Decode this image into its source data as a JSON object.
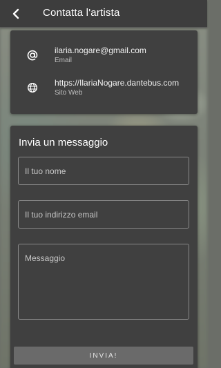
{
  "header": {
    "title": "Contatta l'artista",
    "back_icon": "chevron-left-icon"
  },
  "contact_info": [
    {
      "icon": "at-sign-icon",
      "value": "ilaria.nogare@gmail.com",
      "label": "Email"
    },
    {
      "icon": "globe-icon",
      "value": "https://IlariaNogare.dantebus.com",
      "label": "Sito Web"
    }
  ],
  "message_form": {
    "title": "Invia un messaggio",
    "name_placeholder": "Il tuo nome",
    "name_value": "",
    "email_placeholder": "Il tuo indirizzo email",
    "email_value": "",
    "message_placeholder": "Messaggio",
    "message_value": "",
    "send_label": "INVIA!"
  },
  "colors": {
    "appbar": "#3d3d3d",
    "card": "#404040",
    "field_border": "#8a8a8a",
    "button": "#6a6a6a"
  }
}
